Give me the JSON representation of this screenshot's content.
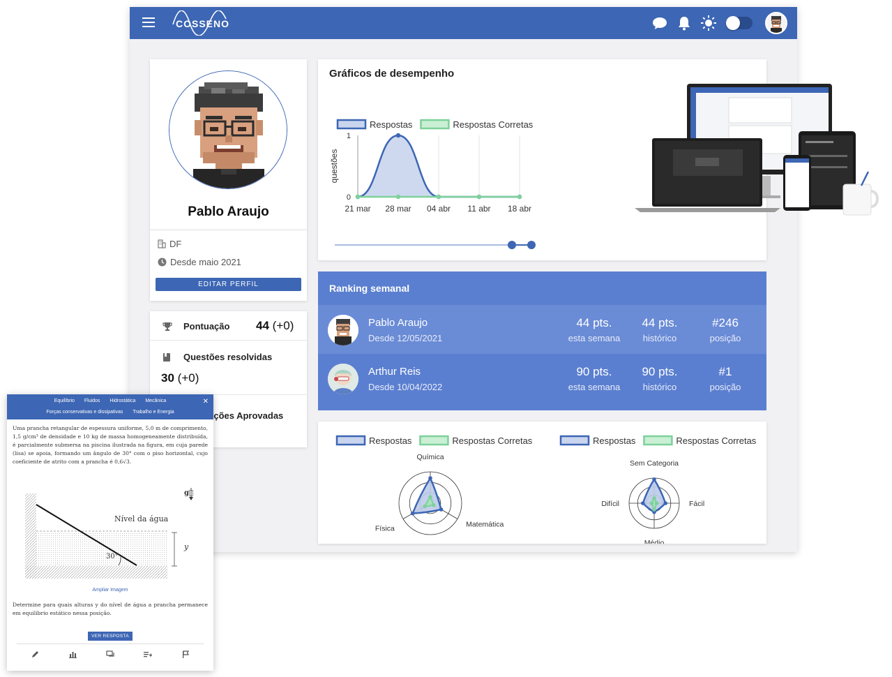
{
  "topbar": {
    "logo_text": "COSSENO",
    "icons": [
      "menu-icon",
      "chat-icon",
      "bell-icon",
      "sun-icon",
      "theme-toggle",
      "avatar"
    ]
  },
  "profile": {
    "name": "Pablo Araujo",
    "location": "DF",
    "since": "Desde maio 2021",
    "edit_label": "EDITAR PERFIL"
  },
  "stats": {
    "score_label": "Pontuação",
    "score_value": "44",
    "score_delta": "(+0)",
    "solved_label": "Questões resolvidas",
    "solved_value": "30",
    "solved_delta": "(+0)",
    "approved_label": "Resoluções Aprovadas"
  },
  "performance": {
    "title": "Gráficos de desempenho",
    "slider_fraction": 1.0
  },
  "chart_data": [
    {
      "type": "area",
      "x": [
        "21 mar",
        "28 mar",
        "04 abr",
        "11 abr",
        "18 abr"
      ],
      "series": [
        {
          "name": "Respostas",
          "values": [
            0,
            1,
            0,
            0,
            0
          ],
          "color": "#3d66b4"
        },
        {
          "name": "Respostas Corretas",
          "values": [
            0,
            0,
            0,
            0,
            0
          ],
          "color": "#7ed19a"
        }
      ],
      "ylabel": "questões",
      "yticks": [
        "0",
        "1"
      ],
      "ylim": [
        0,
        1
      ],
      "legend": "top-left"
    },
    {
      "type": "radar",
      "axes": [
        "Química",
        "Matemática",
        "Física"
      ],
      "series": [
        {
          "name": "Respostas",
          "values": [
            0.8,
            0.4,
            0.65
          ],
          "color": "#3d66b4"
        },
        {
          "name": "Respostas Corretas",
          "values": [
            0.2,
            0.12,
            0.2
          ],
          "color": "#7ed19a"
        }
      ],
      "legend": "top"
    },
    {
      "type": "radar",
      "axes": [
        "Sem Categoria",
        "Fácil",
        "Médio",
        "Difícil"
      ],
      "series": [
        {
          "name": "Respostas",
          "values": [
            0.95,
            0.45,
            0.35,
            0.45
          ],
          "color": "#3d66b4"
        },
        {
          "name": "Respostas Corretas",
          "values": [
            0.2,
            0.1,
            0.25,
            0.1
          ],
          "color": "#7ed19a"
        }
      ],
      "legend": "top"
    }
  ],
  "ranking": {
    "title": "Ranking semanal",
    "rows": [
      {
        "name": "Pablo Araujo",
        "since": "Desde 12/05/2021",
        "week": "44 pts.",
        "week_label": "esta semana",
        "total": "44 pts.",
        "total_label": "histórico",
        "pos": "#246",
        "pos_label": "posição"
      },
      {
        "name": "Arthur Reis",
        "since": "Desde 10/04/2022",
        "week": "90 pts.",
        "week_label": "esta semana",
        "total": "90 pts.",
        "total_label": "histórico",
        "pos": "#1",
        "pos_label": "posição"
      }
    ]
  },
  "mobile": {
    "tabs_row1": [
      "Equilíbrio",
      "Fluidos",
      "Hidrostática",
      "Mecânica"
    ],
    "tabs_row2": [
      "Forças conservativas e dissipativas",
      "Trabalho e Energia"
    ],
    "question": "Uma prancha retangular de espessura uniforme, 5,0 m de comprimento, 1,5 g/cm³ de densidade e 10 kg de massa homogeneamente distribuída, é parcialmente submersa na piscina ilustrada na figura, em cuja parede (lisa) se apoia, formando um ângulo de 30° com o piso horizontal, cujo coeficiente de atrito com a prancha é 0,6√3.",
    "figure_water_label": "Nível da água",
    "figure_angle": "30°",
    "figure_y": "y",
    "figure_g": "g⃗",
    "zoom_link": "Ampliar Imagem",
    "prompt": "Determine para quais alturas y do nível de água a prancha permanece em equilíbrio estático nessa posição.",
    "answer_btn": "VER RESPOSTA"
  }
}
